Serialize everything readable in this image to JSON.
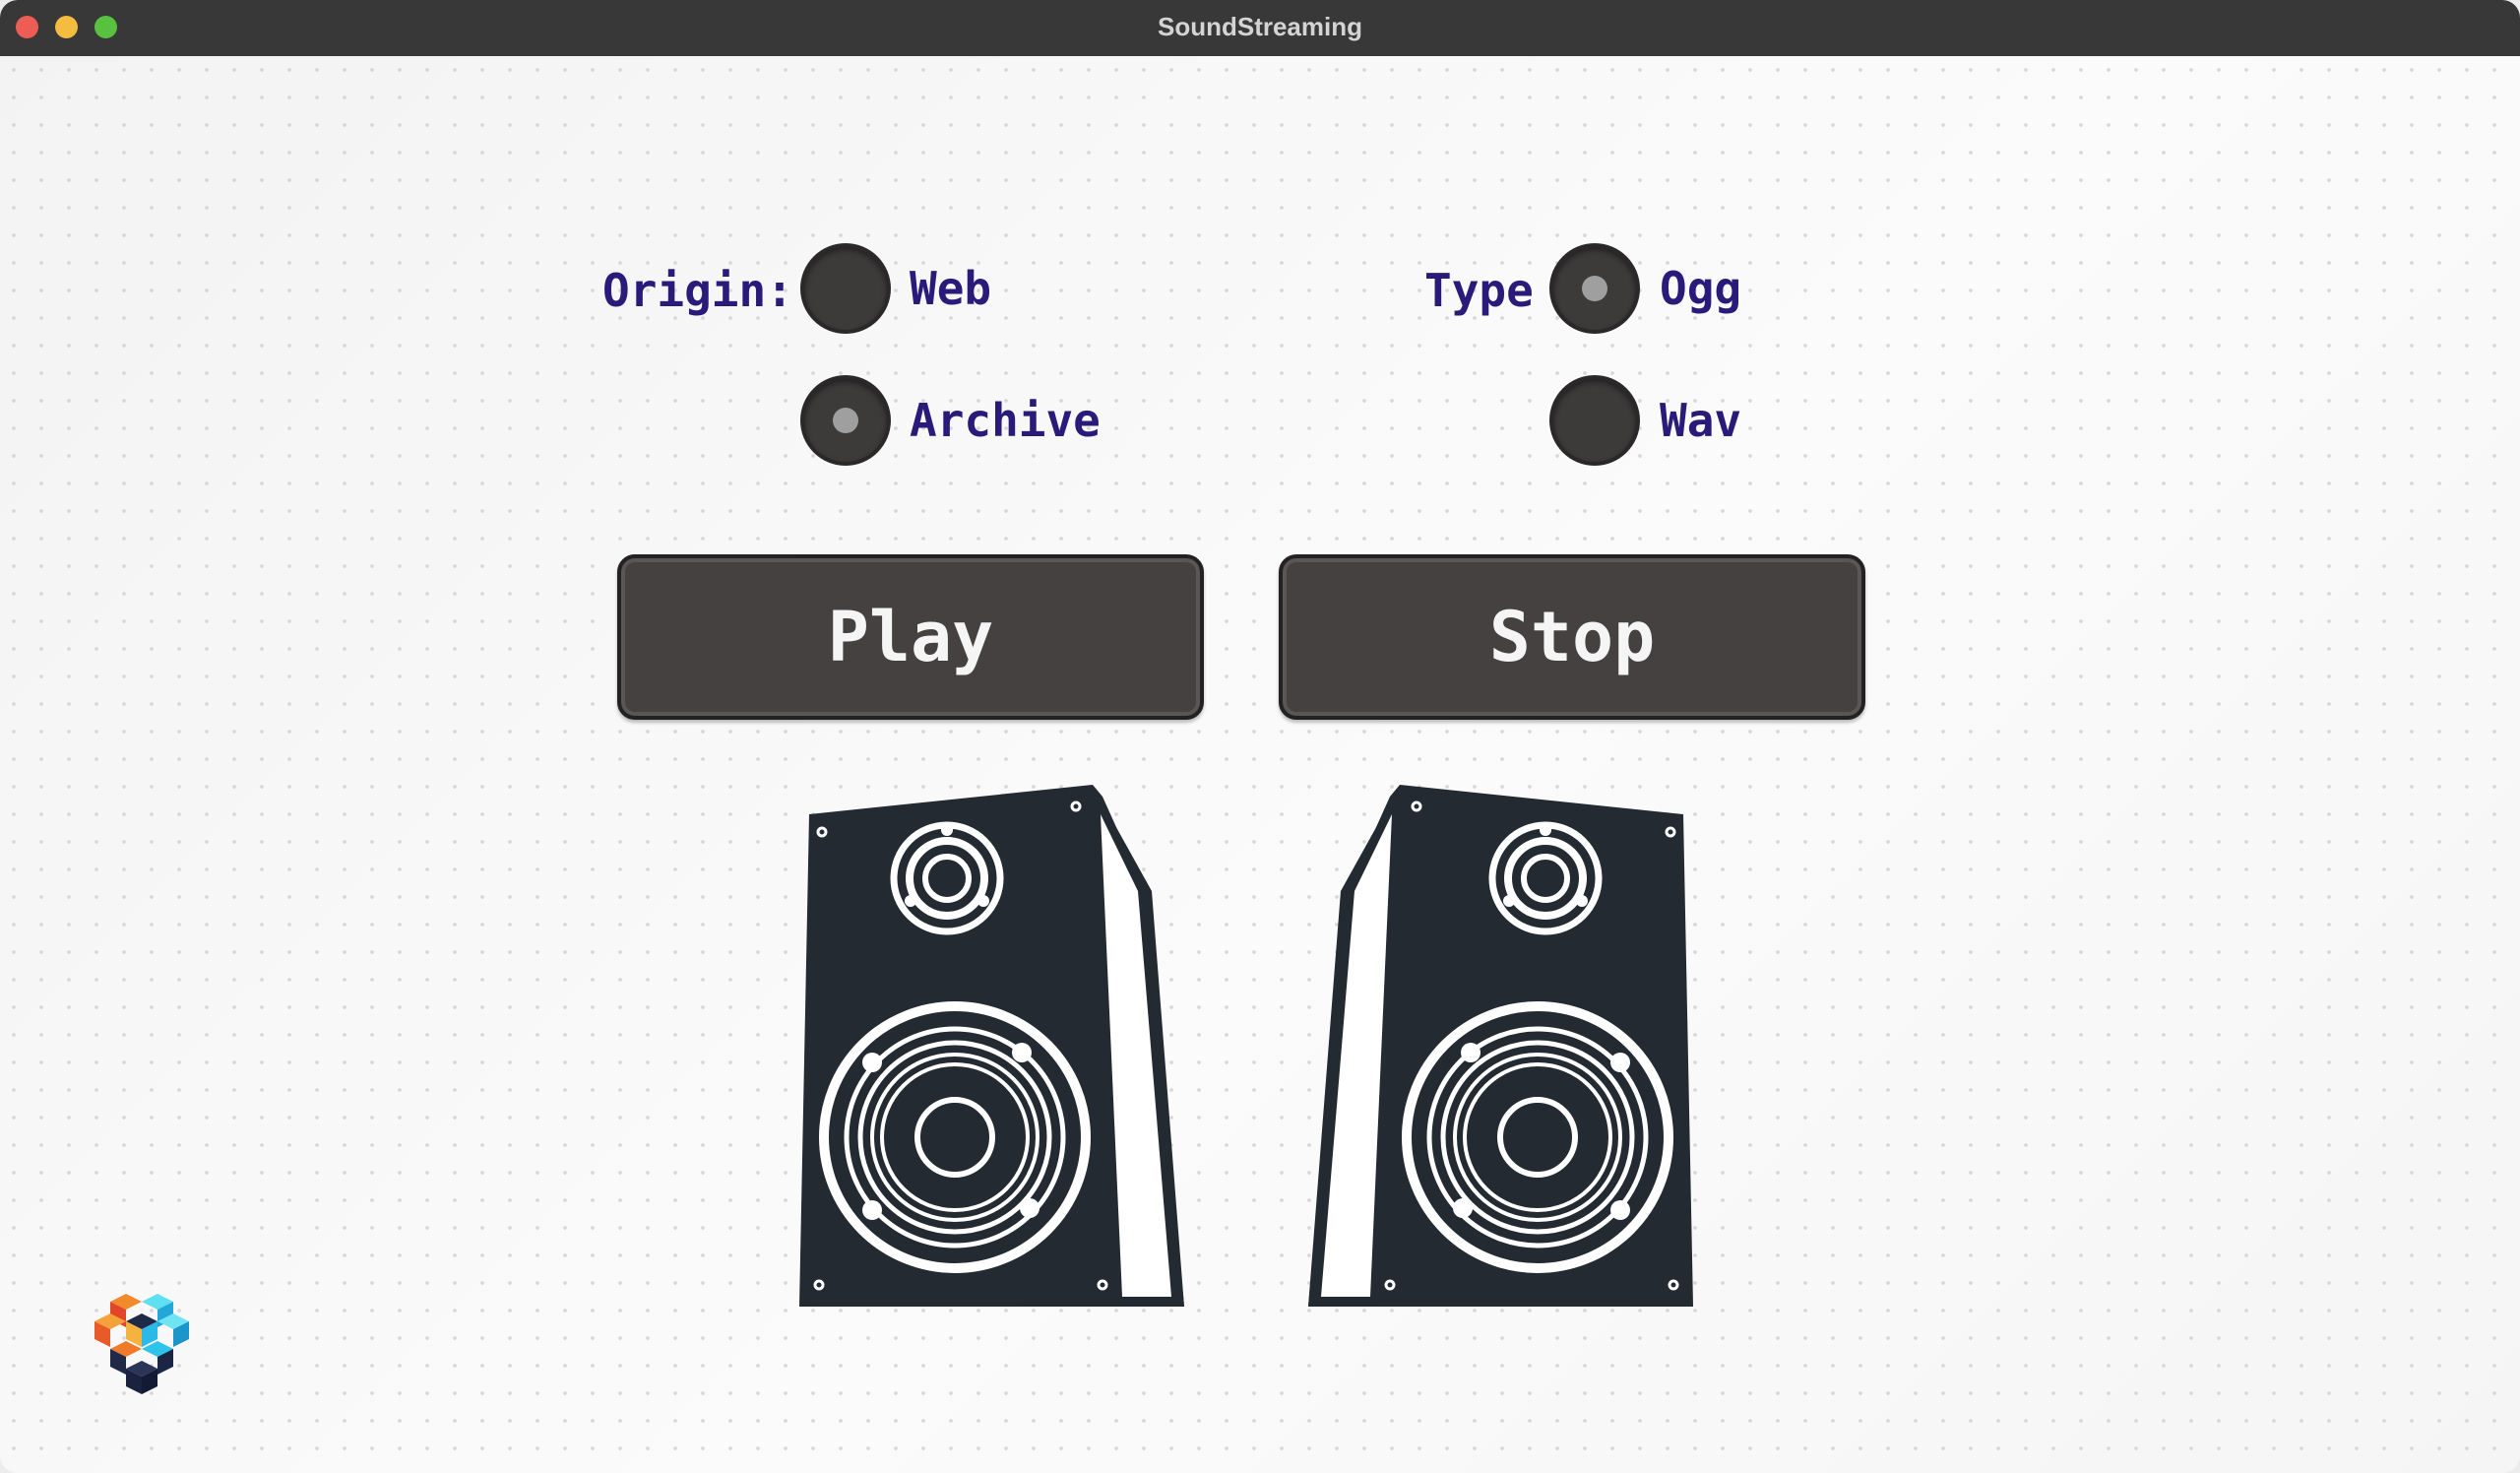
{
  "window": {
    "title": "SoundStreaming"
  },
  "origin": {
    "label": "Origin:",
    "options": [
      {
        "label": "Web",
        "selected": false
      },
      {
        "label": "Archive",
        "selected": true
      }
    ]
  },
  "type": {
    "label": "Type",
    "options": [
      {
        "label": "Ogg",
        "selected": true
      },
      {
        "label": "Wav",
        "selected": false
      }
    ]
  },
  "buttons": {
    "play_label": "Play",
    "stop_label": "Stop"
  },
  "icons": {
    "left_speaker": "speaker-icon",
    "right_speaker": "speaker-icon",
    "app_logo": "cube-logo-icon"
  },
  "colors": {
    "label_text": "#2a1a7a",
    "control_dark": "#3d3a3a",
    "speaker_body": "#232a31"
  }
}
